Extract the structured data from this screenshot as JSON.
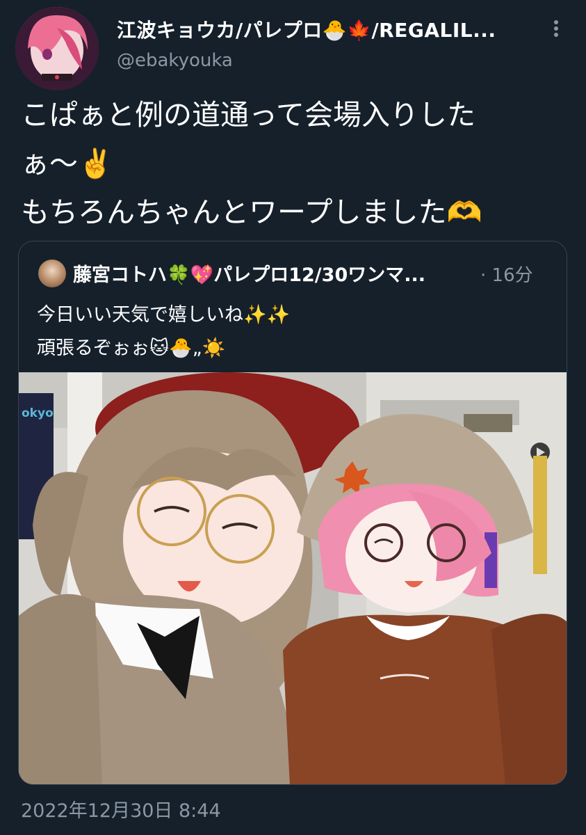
{
  "tweet": {
    "display_name": "江波キョウカ/パレプロ🐣🍁/REGALIL...",
    "handle": "@ebakyouka",
    "text_lines": [
      "こぱぁと例の道通って会場入りした",
      "ぁ〜✌️",
      "もちろんちゃんとワープしました🫶"
    ],
    "timestamp": "2022年12月30日 8:44"
  },
  "quote": {
    "display_name": "藤宮コトハ🍀💖パレプロ12/30ワンマ...",
    "time": "· 16分",
    "text_lines": [
      "今日いい天気で嬉しいね✨✨",
      "頑張るぞぉぉ🐱🐣„☀️"
    ],
    "image_sign_text": "okyo"
  },
  "icons": {
    "more": "more-vertical-icon"
  },
  "colors": {
    "background": "#15202b",
    "text": "#ffffff",
    "muted": "#8b98a5",
    "border": "#38444d"
  }
}
